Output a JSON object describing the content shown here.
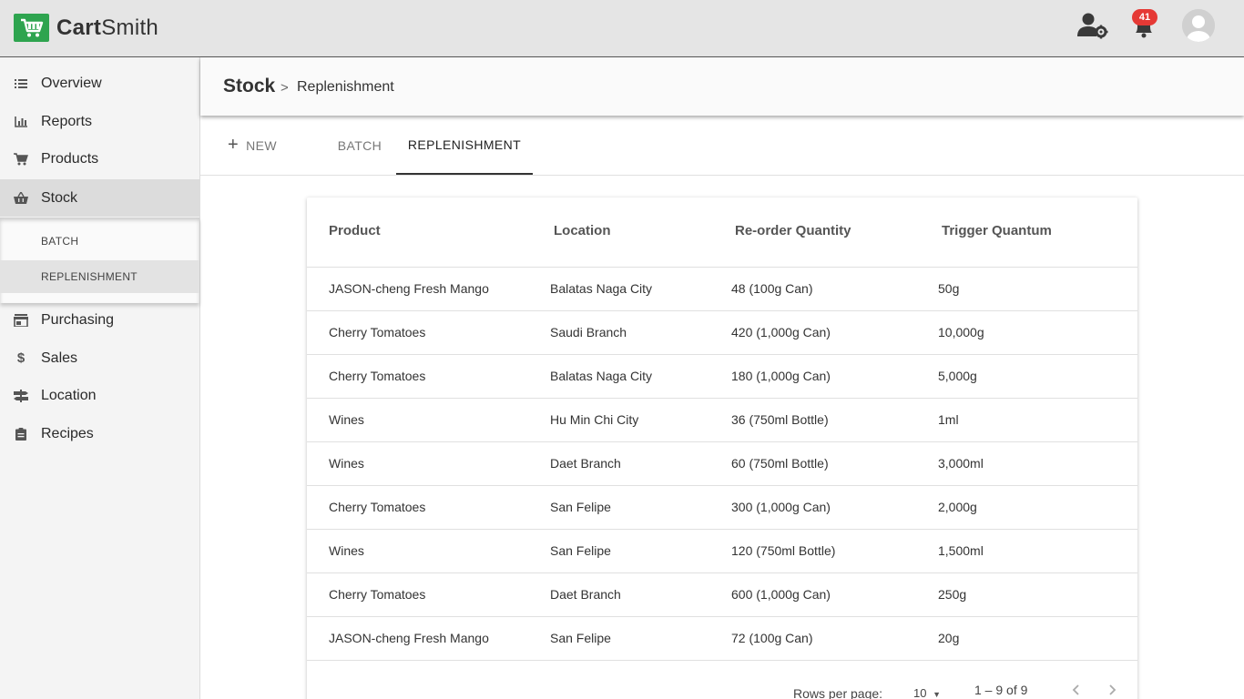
{
  "app": {
    "name_bold": "Cart",
    "name_rest": "Smith"
  },
  "topbar": {
    "notification_count": "41"
  },
  "sidebar": {
    "items": [
      {
        "label": "Overview",
        "icon": "list-icon"
      },
      {
        "label": "Reports",
        "icon": "bar-chart-icon"
      },
      {
        "label": "Products",
        "icon": "cart-icon"
      },
      {
        "label": "Stock",
        "icon": "basket-icon"
      },
      {
        "label": "Purchasing",
        "icon": "store-icon"
      },
      {
        "label": "Sales",
        "icon": "dollar-icon"
      },
      {
        "label": "Location",
        "icon": "signpost-icon"
      },
      {
        "label": "Recipes",
        "icon": "clipboard-icon"
      }
    ],
    "sub_items": [
      {
        "label": "BATCH"
      },
      {
        "label": "REPLENISHMENT"
      }
    ]
  },
  "header": {
    "title": "Stock",
    "separator": ">",
    "subtitle": "Replenishment"
  },
  "tabs": [
    {
      "label": "NEW"
    },
    {
      "label": "BATCH"
    },
    {
      "label": "REPLENISHMENT"
    }
  ],
  "table": {
    "columns": [
      "Product",
      "Location",
      "Re-order Quantity",
      "Trigger Quantum"
    ],
    "rows": [
      [
        "JASON-cheng Fresh Mango",
        "Balatas Naga City",
        "48 (100g Can)",
        "50g"
      ],
      [
        "Cherry Tomatoes",
        "Saudi Branch",
        "420 (1,000g Can)",
        "10,000g"
      ],
      [
        "Cherry Tomatoes",
        "Balatas Naga City",
        "180 (1,000g Can)",
        "5,000g"
      ],
      [
        "Wines",
        "Hu Min Chi City",
        "36 (750ml Bottle)",
        "1ml"
      ],
      [
        "Wines",
        "Daet Branch",
        "60 (750ml Bottle)",
        "3,000ml"
      ],
      [
        "Cherry Tomatoes",
        "San Felipe",
        "300 (1,000g Can)",
        "2,000g"
      ],
      [
        "Wines",
        "San Felipe",
        "120 (750ml Bottle)",
        "1,500ml"
      ],
      [
        "Cherry Tomatoes",
        "Daet Branch",
        "600 (1,000g Can)",
        "250g"
      ],
      [
        "JASON-cheng Fresh Mango",
        "San Felipe",
        "72 (100g Can)",
        "20g"
      ]
    ]
  },
  "pagination": {
    "rows_label": "Rows per page:",
    "rows_value": "10",
    "range": "1 – 9 of 9"
  }
}
